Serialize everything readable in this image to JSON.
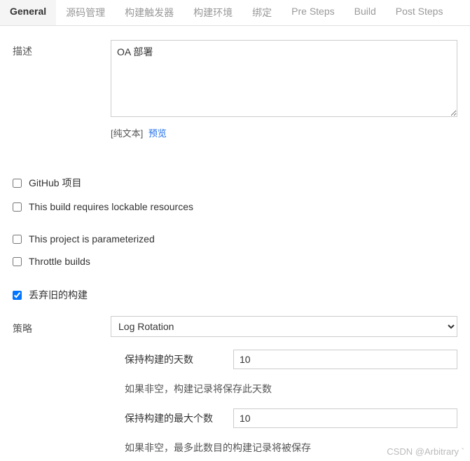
{
  "tabs": {
    "general": "General",
    "scm": "源码管理",
    "triggers": "构建触发器",
    "env": "构建环境",
    "bindings": "绑定",
    "pre": "Pre Steps",
    "build": "Build",
    "post": "Post Steps"
  },
  "description": {
    "label": "描述",
    "value": "OA 部署",
    "format_prefix": "[纯文本]",
    "preview": "预览"
  },
  "checks": {
    "github": "GitHub 项目",
    "lockable": "This build requires lockable resources",
    "param": "This project is parameterized",
    "throttle": "Throttle builds",
    "discard": "丢弃旧的构建"
  },
  "strategy": {
    "label": "策略",
    "selected": "Log Rotation",
    "days_label": "保持构建的天数",
    "days_value": "10",
    "days_help": "如果非空，构建记录将保存此天数",
    "max_label": "保持构建的最大个数",
    "max_value": "10",
    "max_help": "如果非空，最多此数目的构建记录将被保存"
  },
  "watermark": "CSDN @Arbitrary `"
}
